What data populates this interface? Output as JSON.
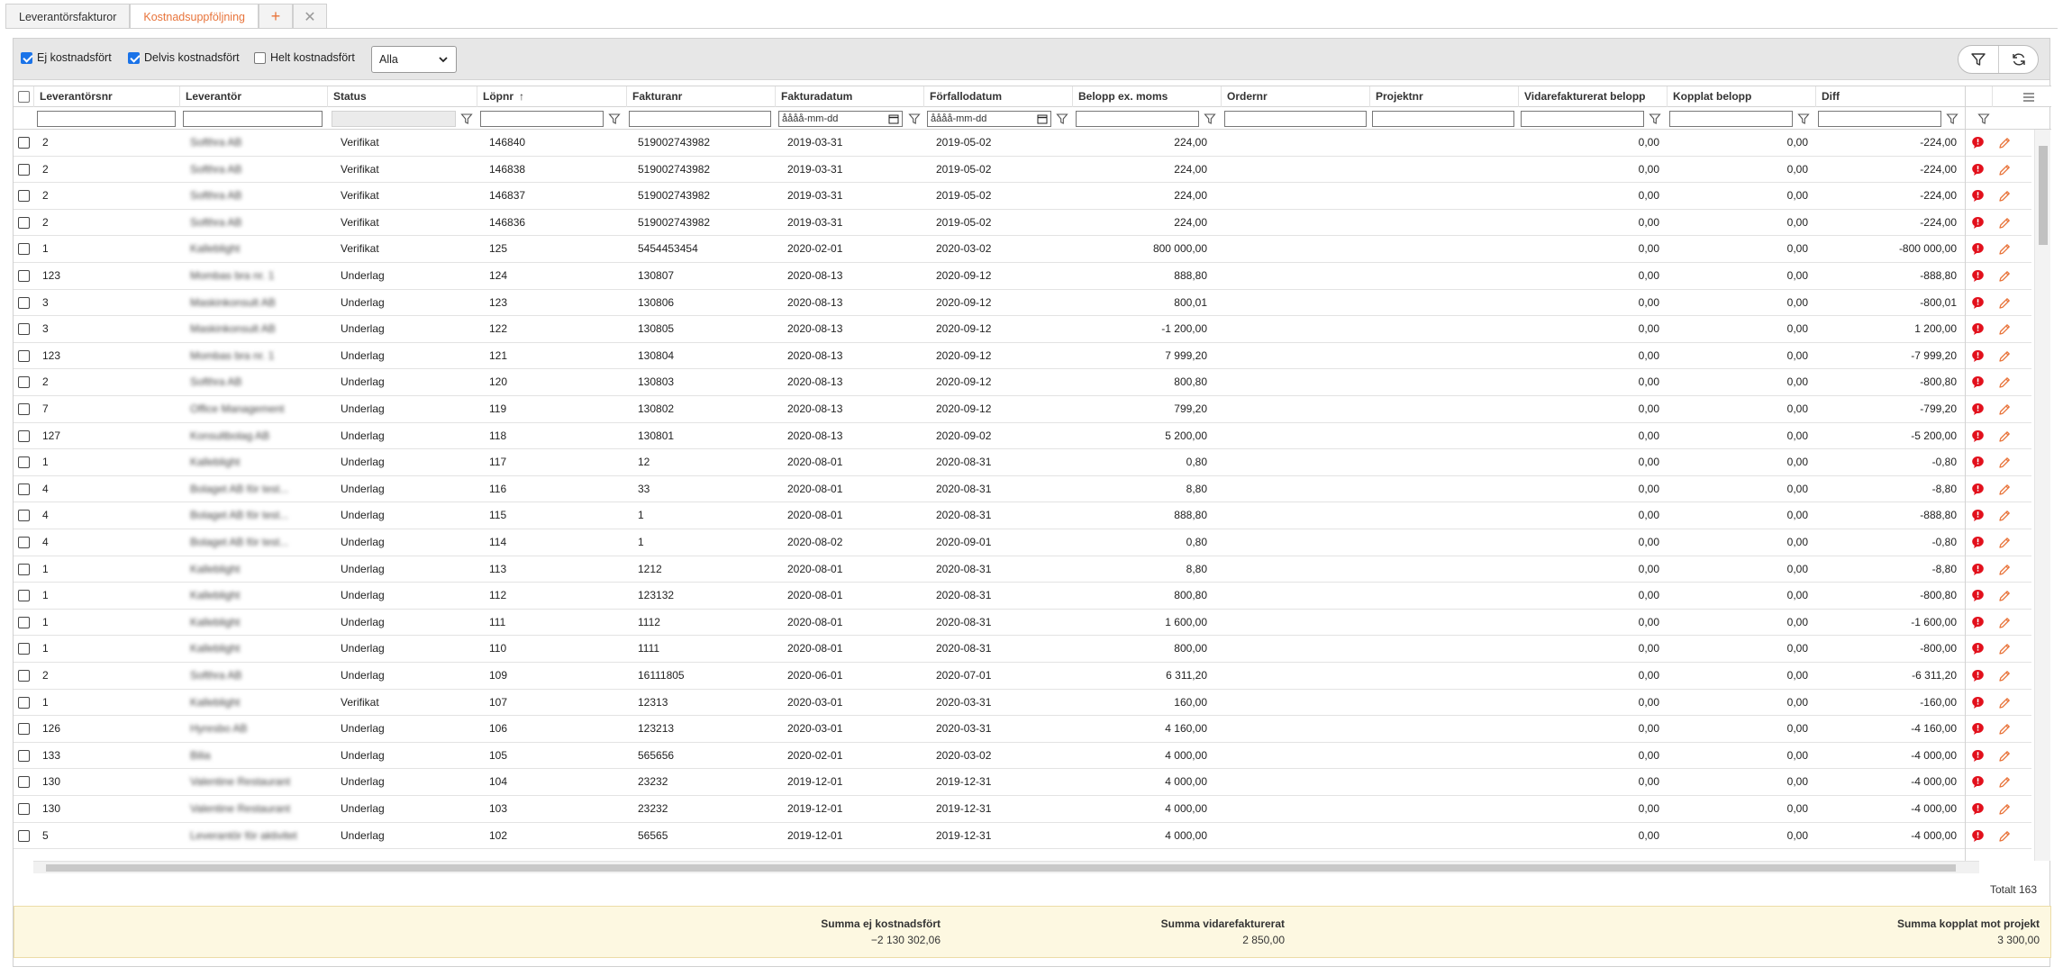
{
  "tabs": [
    {
      "label": "Leverantörsfakturor",
      "active": false
    },
    {
      "label": "Kostnadsuppföljning",
      "active": true
    }
  ],
  "filters": {
    "ej_kostnadsfort": {
      "label": "Ej kostnadsfört",
      "checked": true
    },
    "delvis_kostnadsfort": {
      "label": "Delvis kostnadsfört",
      "checked": true
    },
    "helt_kostnadsfort": {
      "label": "Helt kostnadsfört",
      "checked": false
    },
    "status_select": "Alla"
  },
  "columns": [
    "Leverantörsnr",
    "Leverantör",
    "Status",
    "Löpnr",
    "Fakturanr",
    "Fakturadatum",
    "Förfallodatum",
    "Belopp ex. moms",
    "Ordernr",
    "Projektnr",
    "Vidarefakturerat belopp",
    "Kopplat belopp",
    "Diff"
  ],
  "date_placeholder": "åååå-mm-dd",
  "rows": [
    {
      "levnr": "2",
      "lev": "Softhra AB",
      "status": "Verifikat",
      "lopnr": "146840",
      "faktnr": "519002743982",
      "faktdat": "2019-03-31",
      "forfdat": "2019-05-02",
      "belopp": "224,00",
      "vidare": "0,00",
      "kopplat": "0,00",
      "diff": "-224,00"
    },
    {
      "levnr": "2",
      "lev": "Softhra AB",
      "status": "Verifikat",
      "lopnr": "146838",
      "faktnr": "519002743982",
      "faktdat": "2019-03-31",
      "forfdat": "2019-05-02",
      "belopp": "224,00",
      "vidare": "0,00",
      "kopplat": "0,00",
      "diff": "-224,00"
    },
    {
      "levnr": "2",
      "lev": "Softhra AB",
      "status": "Verifikat",
      "lopnr": "146837",
      "faktnr": "519002743982",
      "faktdat": "2019-03-31",
      "forfdat": "2019-05-02",
      "belopp": "224,00",
      "vidare": "0,00",
      "kopplat": "0,00",
      "diff": "-224,00"
    },
    {
      "levnr": "2",
      "lev": "Softhra AB",
      "status": "Verifikat",
      "lopnr": "146836",
      "faktnr": "519002743982",
      "faktdat": "2019-03-31",
      "forfdat": "2019-05-02",
      "belopp": "224,00",
      "vidare": "0,00",
      "kopplat": "0,00",
      "diff": "-224,00"
    },
    {
      "levnr": "1",
      "lev": "Kalleblight",
      "status": "Verifikat",
      "lopnr": "125",
      "faktnr": "5454453454",
      "faktdat": "2020-02-01",
      "forfdat": "2020-03-02",
      "belopp": "800 000,00",
      "vidare": "0,00",
      "kopplat": "0,00",
      "diff": "-800 000,00"
    },
    {
      "levnr": "123",
      "lev": "Mombas bra nr. 1",
      "status": "Underlag",
      "lopnr": "124",
      "faktnr": "130807",
      "faktdat": "2020-08-13",
      "forfdat": "2020-09-12",
      "belopp": "888,80",
      "vidare": "0,00",
      "kopplat": "0,00",
      "diff": "-888,80"
    },
    {
      "levnr": "3",
      "lev": "Maskinkonsult AB",
      "status": "Underlag",
      "lopnr": "123",
      "faktnr": "130806",
      "faktdat": "2020-08-13",
      "forfdat": "2020-09-12",
      "belopp": "800,01",
      "vidare": "0,00",
      "kopplat": "0,00",
      "diff": "-800,01"
    },
    {
      "levnr": "3",
      "lev": "Maskinkonsult AB",
      "status": "Underlag",
      "lopnr": "122",
      "faktnr": "130805",
      "faktdat": "2020-08-13",
      "forfdat": "2020-09-12",
      "belopp": "-1 200,00",
      "vidare": "0,00",
      "kopplat": "0,00",
      "diff": "1 200,00"
    },
    {
      "levnr": "123",
      "lev": "Mombas bra nr. 1",
      "status": "Underlag",
      "lopnr": "121",
      "faktnr": "130804",
      "faktdat": "2020-08-13",
      "forfdat": "2020-09-12",
      "belopp": "7 999,20",
      "vidare": "0,00",
      "kopplat": "0,00",
      "diff": "-7 999,20"
    },
    {
      "levnr": "2",
      "lev": "Softhra AB",
      "status": "Underlag",
      "lopnr": "120",
      "faktnr": "130803",
      "faktdat": "2020-08-13",
      "forfdat": "2020-09-12",
      "belopp": "800,80",
      "vidare": "0,00",
      "kopplat": "0,00",
      "diff": "-800,80"
    },
    {
      "levnr": "7",
      "lev": "Office Management",
      "status": "Underlag",
      "lopnr": "119",
      "faktnr": "130802",
      "faktdat": "2020-08-13",
      "forfdat": "2020-09-12",
      "belopp": "799,20",
      "vidare": "0,00",
      "kopplat": "0,00",
      "diff": "-799,20"
    },
    {
      "levnr": "127",
      "lev": "Konsultbolag AB",
      "status": "Underlag",
      "lopnr": "118",
      "faktnr": "130801",
      "faktdat": "2020-08-13",
      "forfdat": "2020-09-02",
      "belopp": "5 200,00",
      "vidare": "0,00",
      "kopplat": "0,00",
      "diff": "-5 200,00"
    },
    {
      "levnr": "1",
      "lev": "Kalleblight",
      "status": "Underlag",
      "lopnr": "117",
      "faktnr": "12",
      "faktdat": "2020-08-01",
      "forfdat": "2020-08-31",
      "belopp": "0,80",
      "vidare": "0,00",
      "kopplat": "0,00",
      "diff": "-0,80"
    },
    {
      "levnr": "4",
      "lev": "Bolaget AB för test...",
      "status": "Underlag",
      "lopnr": "116",
      "faktnr": "33",
      "faktdat": "2020-08-01",
      "forfdat": "2020-08-31",
      "belopp": "8,80",
      "vidare": "0,00",
      "kopplat": "0,00",
      "diff": "-8,80"
    },
    {
      "levnr": "4",
      "lev": "Bolaget AB för test...",
      "status": "Underlag",
      "lopnr": "115",
      "faktnr": "1",
      "faktdat": "2020-08-01",
      "forfdat": "2020-08-31",
      "belopp": "888,80",
      "vidare": "0,00",
      "kopplat": "0,00",
      "diff": "-888,80"
    },
    {
      "levnr": "4",
      "lev": "Bolaget AB för test...",
      "status": "Underlag",
      "lopnr": "114",
      "faktnr": "1",
      "faktdat": "2020-08-02",
      "forfdat": "2020-09-01",
      "belopp": "0,80",
      "vidare": "0,00",
      "kopplat": "0,00",
      "diff": "-0,80"
    },
    {
      "levnr": "1",
      "lev": "Kalleblight",
      "status": "Underlag",
      "lopnr": "113",
      "faktnr": "1212",
      "faktdat": "2020-08-01",
      "forfdat": "2020-08-31",
      "belopp": "8,80",
      "vidare": "0,00",
      "kopplat": "0,00",
      "diff": "-8,80"
    },
    {
      "levnr": "1",
      "lev": "Kalleblight",
      "status": "Underlag",
      "lopnr": "112",
      "faktnr": "123132",
      "faktdat": "2020-08-01",
      "forfdat": "2020-08-31",
      "belopp": "800,80",
      "vidare": "0,00",
      "kopplat": "0,00",
      "diff": "-800,80"
    },
    {
      "levnr": "1",
      "lev": "Kalleblight",
      "status": "Underlag",
      "lopnr": "111",
      "faktnr": "1112",
      "faktdat": "2020-08-01",
      "forfdat": "2020-08-31",
      "belopp": "1 600,00",
      "vidare": "0,00",
      "kopplat": "0,00",
      "diff": "-1 600,00"
    },
    {
      "levnr": "1",
      "lev": "Kalleblight",
      "status": "Underlag",
      "lopnr": "110",
      "faktnr": "1111",
      "faktdat": "2020-08-01",
      "forfdat": "2020-08-31",
      "belopp": "800,00",
      "vidare": "0,00",
      "kopplat": "0,00",
      "diff": "-800,00"
    },
    {
      "levnr": "2",
      "lev": "Softhra AB",
      "status": "Underlag",
      "lopnr": "109",
      "faktnr": "16111805",
      "faktdat": "2020-06-01",
      "forfdat": "2020-07-01",
      "belopp": "6 311,20",
      "vidare": "0,00",
      "kopplat": "0,00",
      "diff": "-6 311,20"
    },
    {
      "levnr": "1",
      "lev": "Kalleblight",
      "status": "Verifikat",
      "lopnr": "107",
      "faktnr": "12313",
      "faktdat": "2020-03-01",
      "forfdat": "2020-03-31",
      "belopp": "160,00",
      "vidare": "0,00",
      "kopplat": "0,00",
      "diff": "-160,00"
    },
    {
      "levnr": "126",
      "lev": "Hyresbo AB",
      "status": "Underlag",
      "lopnr": "106",
      "faktnr": "123213",
      "faktdat": "2020-03-01",
      "forfdat": "2020-03-31",
      "belopp": "4 160,00",
      "vidare": "0,00",
      "kopplat": "0,00",
      "diff": "-4 160,00"
    },
    {
      "levnr": "133",
      "lev": "Bilia",
      "status": "Underlag",
      "lopnr": "105",
      "faktnr": "565656",
      "faktdat": "2020-02-01",
      "forfdat": "2020-03-02",
      "belopp": "4 000,00",
      "vidare": "0,00",
      "kopplat": "0,00",
      "diff": "-4 000,00"
    },
    {
      "levnr": "130",
      "lev": "Valentine Restaurant",
      "status": "Underlag",
      "lopnr": "104",
      "faktnr": "23232",
      "faktdat": "2019-12-01",
      "forfdat": "2019-12-31",
      "belopp": "4 000,00",
      "vidare": "0,00",
      "kopplat": "0,00",
      "diff": "-4 000,00"
    },
    {
      "levnr": "130",
      "lev": "Valentine Restaurant",
      "status": "Underlag",
      "lopnr": "103",
      "faktnr": "23232",
      "faktdat": "2019-12-01",
      "forfdat": "2019-12-31",
      "belopp": "4 000,00",
      "vidare": "0,00",
      "kopplat": "0,00",
      "diff": "-4 000,00"
    },
    {
      "levnr": "5",
      "lev": "Leverantör för aktivitet",
      "status": "Underlag",
      "lopnr": "102",
      "faktnr": "56565",
      "faktdat": "2019-12-01",
      "forfdat": "2019-12-31",
      "belopp": "4 000,00",
      "vidare": "0,00",
      "kopplat": "0,00",
      "diff": "-4 000,00"
    }
  ],
  "total_label": "Totalt 163",
  "summary": [
    {
      "label": "Summa ej kostnadsfört",
      "value": "−2 130 302,06"
    },
    {
      "label": "Summa vidarefakturerat",
      "value": "2 850,00"
    },
    {
      "label": "Summa kopplat mot projekt",
      "value": "3 300,00"
    }
  ],
  "icons": {
    "add_tab": "plus-icon",
    "close_tab": "close-icon",
    "filter": "funnel-icon",
    "refresh": "refresh-icon",
    "comment": "comment-icon",
    "edit": "pencil-icon",
    "columns_menu": "menu-icon"
  },
  "colors": {
    "accent": "#e8743b",
    "checkbox": "#1a73e8",
    "summary_bg": "#fdf8e1",
    "comment_red": "#e2101c"
  }
}
